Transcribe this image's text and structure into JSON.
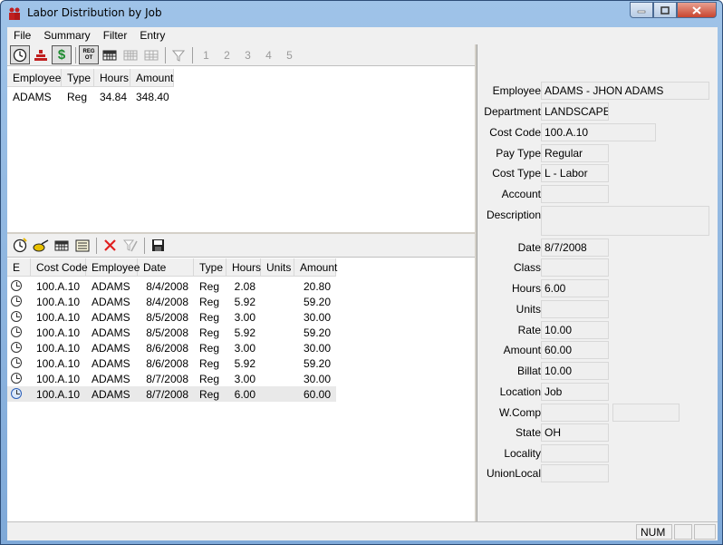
{
  "window": {
    "title": "Labor Distribution by Job"
  },
  "menu": [
    "File",
    "Summary",
    "Filter",
    "Entry"
  ],
  "toolbar_top": {
    "icons": [
      "clock-icon",
      "stacked-bars-icon",
      "dollar-icon",
      "reg-ot-icon",
      "grid-icon",
      "grid-disabled-icon",
      "grid2-disabled-icon",
      "filter-icon"
    ],
    "dollar_glyph": "$",
    "reg_ot_top": "REG",
    "reg_ot_bottom": "OT",
    "numbers": [
      "1",
      "2",
      "3",
      "4",
      "5"
    ]
  },
  "summary": {
    "columns": [
      "Employee",
      "Type",
      "Hours",
      "Amount"
    ],
    "rows": [
      {
        "employee": "ADAMS",
        "type": "Reg",
        "hours": "34.84",
        "amount": "348.40"
      }
    ]
  },
  "toolbar_bottom": {
    "icons": [
      "clock-add-icon",
      "clock-edit-icon",
      "grid-icon",
      "list-icon",
      "delete-icon",
      "clear-filter-icon",
      "save-icon"
    ]
  },
  "detail": {
    "columns": [
      "E",
      "Cost Code",
      "Employee",
      "Date",
      "Type",
      "Hours",
      "Units",
      "Amount"
    ],
    "rows": [
      {
        "cost_code": "100.A.10",
        "employee": "ADAMS",
        "date": "8/4/2008",
        "type": "Reg",
        "hours": "2.08",
        "units": "",
        "amount": "20.80"
      },
      {
        "cost_code": "100.A.10",
        "employee": "ADAMS",
        "date": "8/4/2008",
        "type": "Reg",
        "hours": "5.92",
        "units": "",
        "amount": "59.20"
      },
      {
        "cost_code": "100.A.10",
        "employee": "ADAMS",
        "date": "8/5/2008",
        "type": "Reg",
        "hours": "3.00",
        "units": "",
        "amount": "30.00"
      },
      {
        "cost_code": "100.A.10",
        "employee": "ADAMS",
        "date": "8/5/2008",
        "type": "Reg",
        "hours": "5.92",
        "units": "",
        "amount": "59.20"
      },
      {
        "cost_code": "100.A.10",
        "employee": "ADAMS",
        "date": "8/6/2008",
        "type": "Reg",
        "hours": "3.00",
        "units": "",
        "amount": "30.00"
      },
      {
        "cost_code": "100.A.10",
        "employee": "ADAMS",
        "date": "8/6/2008",
        "type": "Reg",
        "hours": "5.92",
        "units": "",
        "amount": "59.20"
      },
      {
        "cost_code": "100.A.10",
        "employee": "ADAMS",
        "date": "8/7/2008",
        "type": "Reg",
        "hours": "3.00",
        "units": "",
        "amount": "30.00"
      },
      {
        "cost_code": "100.A.10",
        "employee": "ADAMS",
        "date": "8/7/2008",
        "type": "Reg",
        "hours": "6.00",
        "units": "",
        "amount": "60.00"
      }
    ]
  },
  "form": {
    "employee": {
      "label": "Employee",
      "value": "ADAMS - JHON ADAMS"
    },
    "department": {
      "label": "Department",
      "value": "LANDSCAPE"
    },
    "cost_code": {
      "label": "Cost Code",
      "value": "100.A.10"
    },
    "pay_type": {
      "label": "Pay Type",
      "value": "Regular"
    },
    "cost_type": {
      "label": "Cost Type",
      "value": "L - Labor"
    },
    "account": {
      "label": "Account",
      "value": ""
    },
    "description": {
      "label": "Description",
      "value": ""
    },
    "date": {
      "label": "Date",
      "value": "8/7/2008"
    },
    "class": {
      "label": "Class",
      "value": ""
    },
    "hours": {
      "label": "Hours",
      "value": "6.00"
    },
    "units": {
      "label": "Units",
      "value": ""
    },
    "rate": {
      "label": "Rate",
      "value": "10.00"
    },
    "amount": {
      "label": "Amount",
      "value": "60.00"
    },
    "billat": {
      "label": "Billat",
      "value": "10.00"
    },
    "location": {
      "label": "Location",
      "value": "Job"
    },
    "wcomp": {
      "label": "W.Comp",
      "value": "",
      "value2": ""
    },
    "state": {
      "label": "State",
      "value": "OH"
    },
    "locality": {
      "label": "Locality",
      "value": ""
    },
    "union_local": {
      "label": "UnionLocal",
      "value": ""
    }
  },
  "status": {
    "num": "NUM"
  },
  "colors": {
    "title_bg": "#9fc3e8",
    "close_btn": "#c8452f",
    "delete_red": "#e02020",
    "dollar_green": "#1c8a2e"
  }
}
